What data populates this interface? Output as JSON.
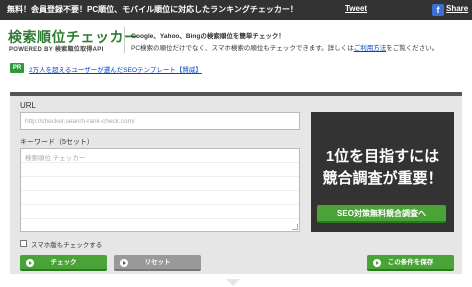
{
  "topbar": {
    "message": "無料！会員登録不要！PC順位、モバイル順位に対応したランキングチェッカー！",
    "tweet": "Tweet",
    "fb_icon": "f",
    "share": "Share"
  },
  "header": {
    "title": "検索順位チェッカー",
    "subtitle": "POWERED BY 検索順位取得API",
    "desc_line1": "Google、Yahoo、Bingの検索順位を簡単チェック！",
    "desc_line2_pre": "PC検索の順位だけでなく、スマホ検索の順位もチェックできます。詳しくは",
    "desc_line2_link": "ご利用方法",
    "desc_line2_post": "をご覧ください。"
  },
  "pr": {
    "badge": "PR",
    "link": "2万人を超えるユーザーが選んだSEOテンプレート【賢威】"
  },
  "form": {
    "url_label": "URL",
    "url_placeholder": "http://checker.search-rank-check.com/",
    "keyword_label": "キーワード（5セット）",
    "keyword_placeholder": "検索順位 チェッカー",
    "mobile_checkbox_label": "スマホ版もチェックする",
    "check_button": "チェック",
    "reset_button": "リセット",
    "save_button": "この条件を保存"
  },
  "ad": {
    "headline_1": "1位を目指すには",
    "headline_2": "競合調査が重要！",
    "cta": "SEO対策無料競合調査へ"
  },
  "colors": {
    "topbar": "#333333",
    "brand_green": "#2e7d32",
    "button_green": "#4aa336",
    "button_gray": "#999999",
    "panel_bg": "#e6e6e6",
    "ad_bg": "#333333",
    "link_blue": "#0044cc"
  }
}
